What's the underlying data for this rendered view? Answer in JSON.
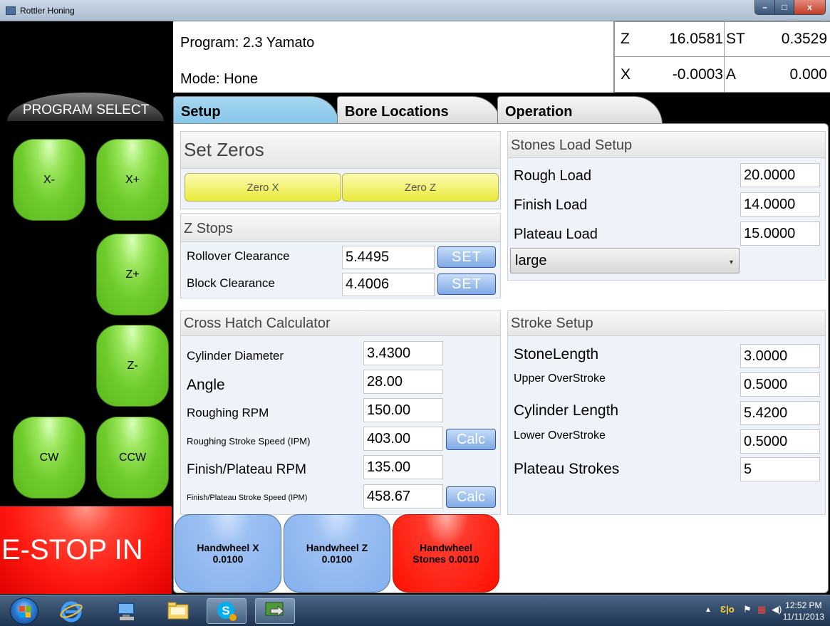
{
  "window": {
    "title": "Rottler Honing",
    "minimize": "–",
    "maximize": "□",
    "close": "x"
  },
  "left": {
    "program_select": "PROGRAM SELECT",
    "buttons": {
      "x_minus": "X-",
      "x_plus": "X+",
      "z_plus": "Z+",
      "z_minus": "Z-",
      "cw": "CW",
      "ccw": "CCW"
    },
    "estop": "E-STOP IN"
  },
  "header": {
    "program": "Program: 2.3 Yamato",
    "mode": "Mode: Hone",
    "readouts": {
      "z_label": "Z",
      "z_value": "16.0581",
      "st_label": "ST",
      "st_value": "0.3529",
      "x_label": "X",
      "x_value": "-0.0003",
      "a_label": "A",
      "a_value": "0.000"
    }
  },
  "tabs": [
    {
      "label": "Setup",
      "active": true
    },
    {
      "label": "Bore Locations",
      "active": false
    },
    {
      "label": "Operation",
      "active": false
    }
  ],
  "set_zeros": {
    "title": "Set Zeros",
    "zero_x": "Zero X",
    "zero_z": "Zero Z"
  },
  "z_stops": {
    "title": "Z Stops",
    "rollover_label": "Rollover Clearance",
    "rollover_value": "5.4495",
    "block_label": "Block Clearance",
    "block_value": "4.4006",
    "set_label": "SET"
  },
  "cross_hatch": {
    "title": "Cross Hatch Calculator",
    "rows": [
      {
        "label": "Cylinder Diameter",
        "value": "3.4300"
      },
      {
        "label": "Angle",
        "value": "28.00"
      },
      {
        "label": "Roughing RPM",
        "value": "150.00"
      },
      {
        "label": "Roughing Stroke Speed (IPM)",
        "value": "403.00"
      },
      {
        "label": "Finish/Plateau RPM",
        "value": "135.00"
      },
      {
        "label": "Finish/Plateau Stroke Speed (IPM)",
        "value": "458.67"
      }
    ],
    "calc_label": "Calc"
  },
  "stones_load": {
    "title": "Stones Load Setup",
    "rows": [
      {
        "label": "Rough Load",
        "value": "20.0000"
      },
      {
        "label": "Finish Load",
        "value": "14.0000"
      },
      {
        "label": "Plateau Load",
        "value": "15.0000"
      }
    ],
    "size_selected": "large"
  },
  "stroke_setup": {
    "title": "Stroke Setup",
    "rows": [
      {
        "label": "StoneLength",
        "value": "3.0000"
      },
      {
        "label": "Upper OverStroke",
        "value": "0.5000"
      },
      {
        "label": "Cylinder Length",
        "value": "5.4200"
      },
      {
        "label": "Lower OverStroke",
        "value": "0.5000"
      },
      {
        "label": "Plateau Strokes",
        "value": "5"
      }
    ]
  },
  "handwheels": [
    {
      "line1": "Handwheel X",
      "line2": "0.0100"
    },
    {
      "line1": "Handwheel Z",
      "line2": "0.0100"
    },
    {
      "line1": "Handwheel",
      "line2": "Stones 0.0010"
    }
  ],
  "taskbar": {
    "time": "12:52 PM",
    "date": "11/11/2013"
  }
}
